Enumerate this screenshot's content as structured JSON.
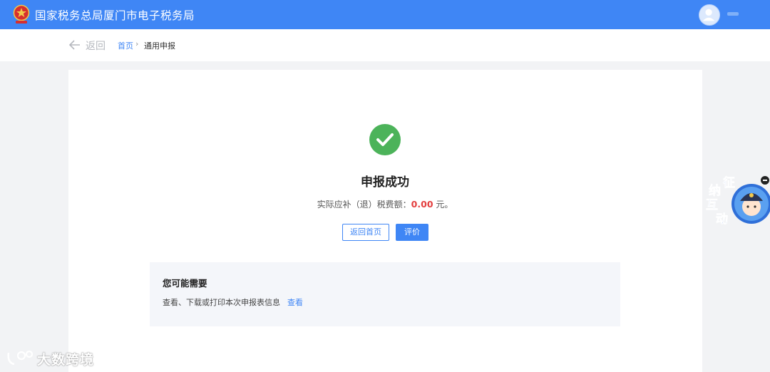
{
  "header": {
    "site_title": "国家税务总局厦门市电子税务局"
  },
  "nav": {
    "back_label": "返回",
    "breadcrumb": {
      "home": "首页",
      "separator": "›",
      "current": "通用申报"
    }
  },
  "result": {
    "title": "申报成功",
    "amount_prefix": "实际应补（退）税费额：",
    "amount_value": "0.00",
    "amount_suffix": " 元。"
  },
  "actions": {
    "home_label": "返回首页",
    "rate_label": "评价"
  },
  "suggestions": {
    "title": "您可能需要",
    "item_text": "查看、下载或打印本次申报表信息",
    "item_link": "查看"
  },
  "widget": {
    "chars": [
      "征",
      "纳",
      "互",
      "动"
    ]
  },
  "watermark": {
    "text": "大数跨境"
  },
  "colors": {
    "brand": "#3f86f5",
    "success": "#4cb35a",
    "amount": "#e33e3e"
  }
}
